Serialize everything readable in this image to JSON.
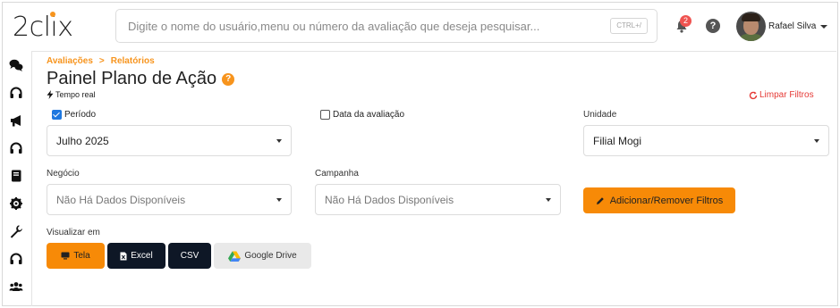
{
  "header": {
    "logo_text": "2clix",
    "search_placeholder": "Digite o nome do usuário,menu ou número da avaliação que deseja pesquisar...",
    "search_shortcut": "CTRL+/",
    "notification_count": "2",
    "help_glyph": "?",
    "user_name": "Rafael Silva"
  },
  "sidebar": {
    "items": [
      {
        "icon": "chat-bubbles-icon"
      },
      {
        "icon": "headset-icon"
      },
      {
        "icon": "megaphone-icon"
      },
      {
        "icon": "headset-icon"
      },
      {
        "icon": "book-icon"
      },
      {
        "icon": "gear-question-icon"
      },
      {
        "icon": "wrench-icon"
      },
      {
        "icon": "headset-icon"
      },
      {
        "icon": "users-icon"
      }
    ]
  },
  "breadcrumb": {
    "items": [
      "Avaliações",
      ">",
      "Relatórios"
    ]
  },
  "page": {
    "title": "Painel Plano de Ação",
    "title_help": "?",
    "realtime_label": "Tempo real",
    "clear_filters": "Limpar Filtros"
  },
  "filters": {
    "periodo": {
      "label": "Período",
      "checked": true,
      "value": "Julho 2025"
    },
    "data_avaliacao": {
      "label": "Data da avaliação",
      "checked": false
    },
    "unidade": {
      "label": "Unidade",
      "value": "Filial Mogi"
    },
    "negocio": {
      "label": "Negócio",
      "value": "Não Há Dados Disponíveis"
    },
    "campanha": {
      "label": "Campanha",
      "value": "Não Há Dados Disponíveis"
    },
    "add_remove_button": "Adicionar/Remover Filtros"
  },
  "view": {
    "label": "Visualizar em",
    "buttons": {
      "tela": "Tela",
      "excel": "Excel",
      "csv": "CSV",
      "drive": "Google Drive"
    }
  },
  "colors": {
    "accent": "#f78a07",
    "breadcrumb": "#f7941d",
    "dark_button": "#0e1726",
    "danger": "#e53935",
    "checkbox": "#1e78e0"
  }
}
